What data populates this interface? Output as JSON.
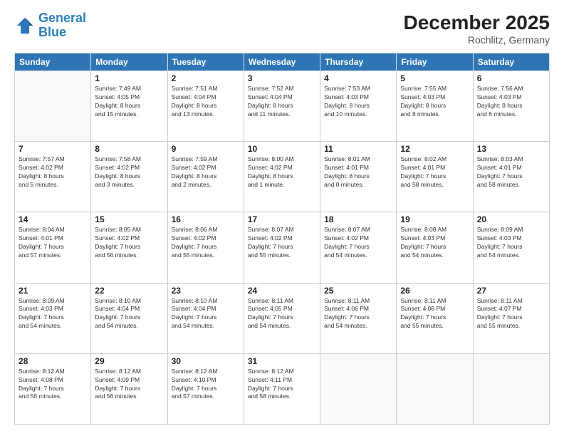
{
  "logo": {
    "line1": "General",
    "line2": "Blue"
  },
  "header": {
    "month_year": "December 2025",
    "location": "Rochlitz, Germany"
  },
  "days_of_week": [
    "Sunday",
    "Monday",
    "Tuesday",
    "Wednesday",
    "Thursday",
    "Friday",
    "Saturday"
  ],
  "weeks": [
    [
      {
        "day": "",
        "info": ""
      },
      {
        "day": "1",
        "info": "Sunrise: 7:49 AM\nSunset: 4:05 PM\nDaylight: 8 hours\nand 15 minutes."
      },
      {
        "day": "2",
        "info": "Sunrise: 7:51 AM\nSunset: 4:04 PM\nDaylight: 8 hours\nand 13 minutes."
      },
      {
        "day": "3",
        "info": "Sunrise: 7:52 AM\nSunset: 4:04 PM\nDaylight: 8 hours\nand 11 minutes."
      },
      {
        "day": "4",
        "info": "Sunrise: 7:53 AM\nSunset: 4:03 PM\nDaylight: 8 hours\nand 10 minutes."
      },
      {
        "day": "5",
        "info": "Sunrise: 7:55 AM\nSunset: 4:03 PM\nDaylight: 8 hours\nand 8 minutes."
      },
      {
        "day": "6",
        "info": "Sunrise: 7:56 AM\nSunset: 4:03 PM\nDaylight: 8 hours\nand 6 minutes."
      }
    ],
    [
      {
        "day": "7",
        "info": "Sunrise: 7:57 AM\nSunset: 4:02 PM\nDaylight: 8 hours\nand 5 minutes."
      },
      {
        "day": "8",
        "info": "Sunrise: 7:58 AM\nSunset: 4:02 PM\nDaylight: 8 hours\nand 3 minutes."
      },
      {
        "day": "9",
        "info": "Sunrise: 7:59 AM\nSunset: 4:02 PM\nDaylight: 8 hours\nand 2 minutes."
      },
      {
        "day": "10",
        "info": "Sunrise: 8:00 AM\nSunset: 4:02 PM\nDaylight: 8 hours\nand 1 minute."
      },
      {
        "day": "11",
        "info": "Sunrise: 8:01 AM\nSunset: 4:01 PM\nDaylight: 8 hours\nand 0 minutes."
      },
      {
        "day": "12",
        "info": "Sunrise: 8:02 AM\nSunset: 4:01 PM\nDaylight: 7 hours\nand 58 minutes."
      },
      {
        "day": "13",
        "info": "Sunrise: 8:03 AM\nSunset: 4:01 PM\nDaylight: 7 hours\nand 58 minutes."
      }
    ],
    [
      {
        "day": "14",
        "info": "Sunrise: 8:04 AM\nSunset: 4:01 PM\nDaylight: 7 hours\nand 57 minutes."
      },
      {
        "day": "15",
        "info": "Sunrise: 8:05 AM\nSunset: 4:02 PM\nDaylight: 7 hours\nand 56 minutes."
      },
      {
        "day": "16",
        "info": "Sunrise: 8:06 AM\nSunset: 4:02 PM\nDaylight: 7 hours\nand 55 minutes."
      },
      {
        "day": "17",
        "info": "Sunrise: 8:07 AM\nSunset: 4:02 PM\nDaylight: 7 hours\nand 55 minutes."
      },
      {
        "day": "18",
        "info": "Sunrise: 8:07 AM\nSunset: 4:02 PM\nDaylight: 7 hours\nand 54 minutes."
      },
      {
        "day": "19",
        "info": "Sunrise: 8:08 AM\nSunset: 4:03 PM\nDaylight: 7 hours\nand 54 minutes."
      },
      {
        "day": "20",
        "info": "Sunrise: 8:09 AM\nSunset: 4:03 PM\nDaylight: 7 hours\nand 54 minutes."
      }
    ],
    [
      {
        "day": "21",
        "info": "Sunrise: 8:09 AM\nSunset: 4:03 PM\nDaylight: 7 hours\nand 54 minutes."
      },
      {
        "day": "22",
        "info": "Sunrise: 8:10 AM\nSunset: 4:04 PM\nDaylight: 7 hours\nand 54 minutes."
      },
      {
        "day": "23",
        "info": "Sunrise: 8:10 AM\nSunset: 4:04 PM\nDaylight: 7 hours\nand 54 minutes."
      },
      {
        "day": "24",
        "info": "Sunrise: 8:11 AM\nSunset: 4:05 PM\nDaylight: 7 hours\nand 54 minutes."
      },
      {
        "day": "25",
        "info": "Sunrise: 8:11 AM\nSunset: 4:06 PM\nDaylight: 7 hours\nand 54 minutes."
      },
      {
        "day": "26",
        "info": "Sunrise: 8:11 AM\nSunset: 4:06 PM\nDaylight: 7 hours\nand 55 minutes."
      },
      {
        "day": "27",
        "info": "Sunrise: 8:11 AM\nSunset: 4:07 PM\nDaylight: 7 hours\nand 55 minutes."
      }
    ],
    [
      {
        "day": "28",
        "info": "Sunrise: 8:12 AM\nSunset: 4:08 PM\nDaylight: 7 hours\nand 56 minutes."
      },
      {
        "day": "29",
        "info": "Sunrise: 8:12 AM\nSunset: 4:09 PM\nDaylight: 7 hours\nand 56 minutes."
      },
      {
        "day": "30",
        "info": "Sunrise: 8:12 AM\nSunset: 4:10 PM\nDaylight: 7 hours\nand 57 minutes."
      },
      {
        "day": "31",
        "info": "Sunrise: 8:12 AM\nSunset: 4:11 PM\nDaylight: 7 hours\nand 58 minutes."
      },
      {
        "day": "",
        "info": ""
      },
      {
        "day": "",
        "info": ""
      },
      {
        "day": "",
        "info": ""
      }
    ]
  ]
}
